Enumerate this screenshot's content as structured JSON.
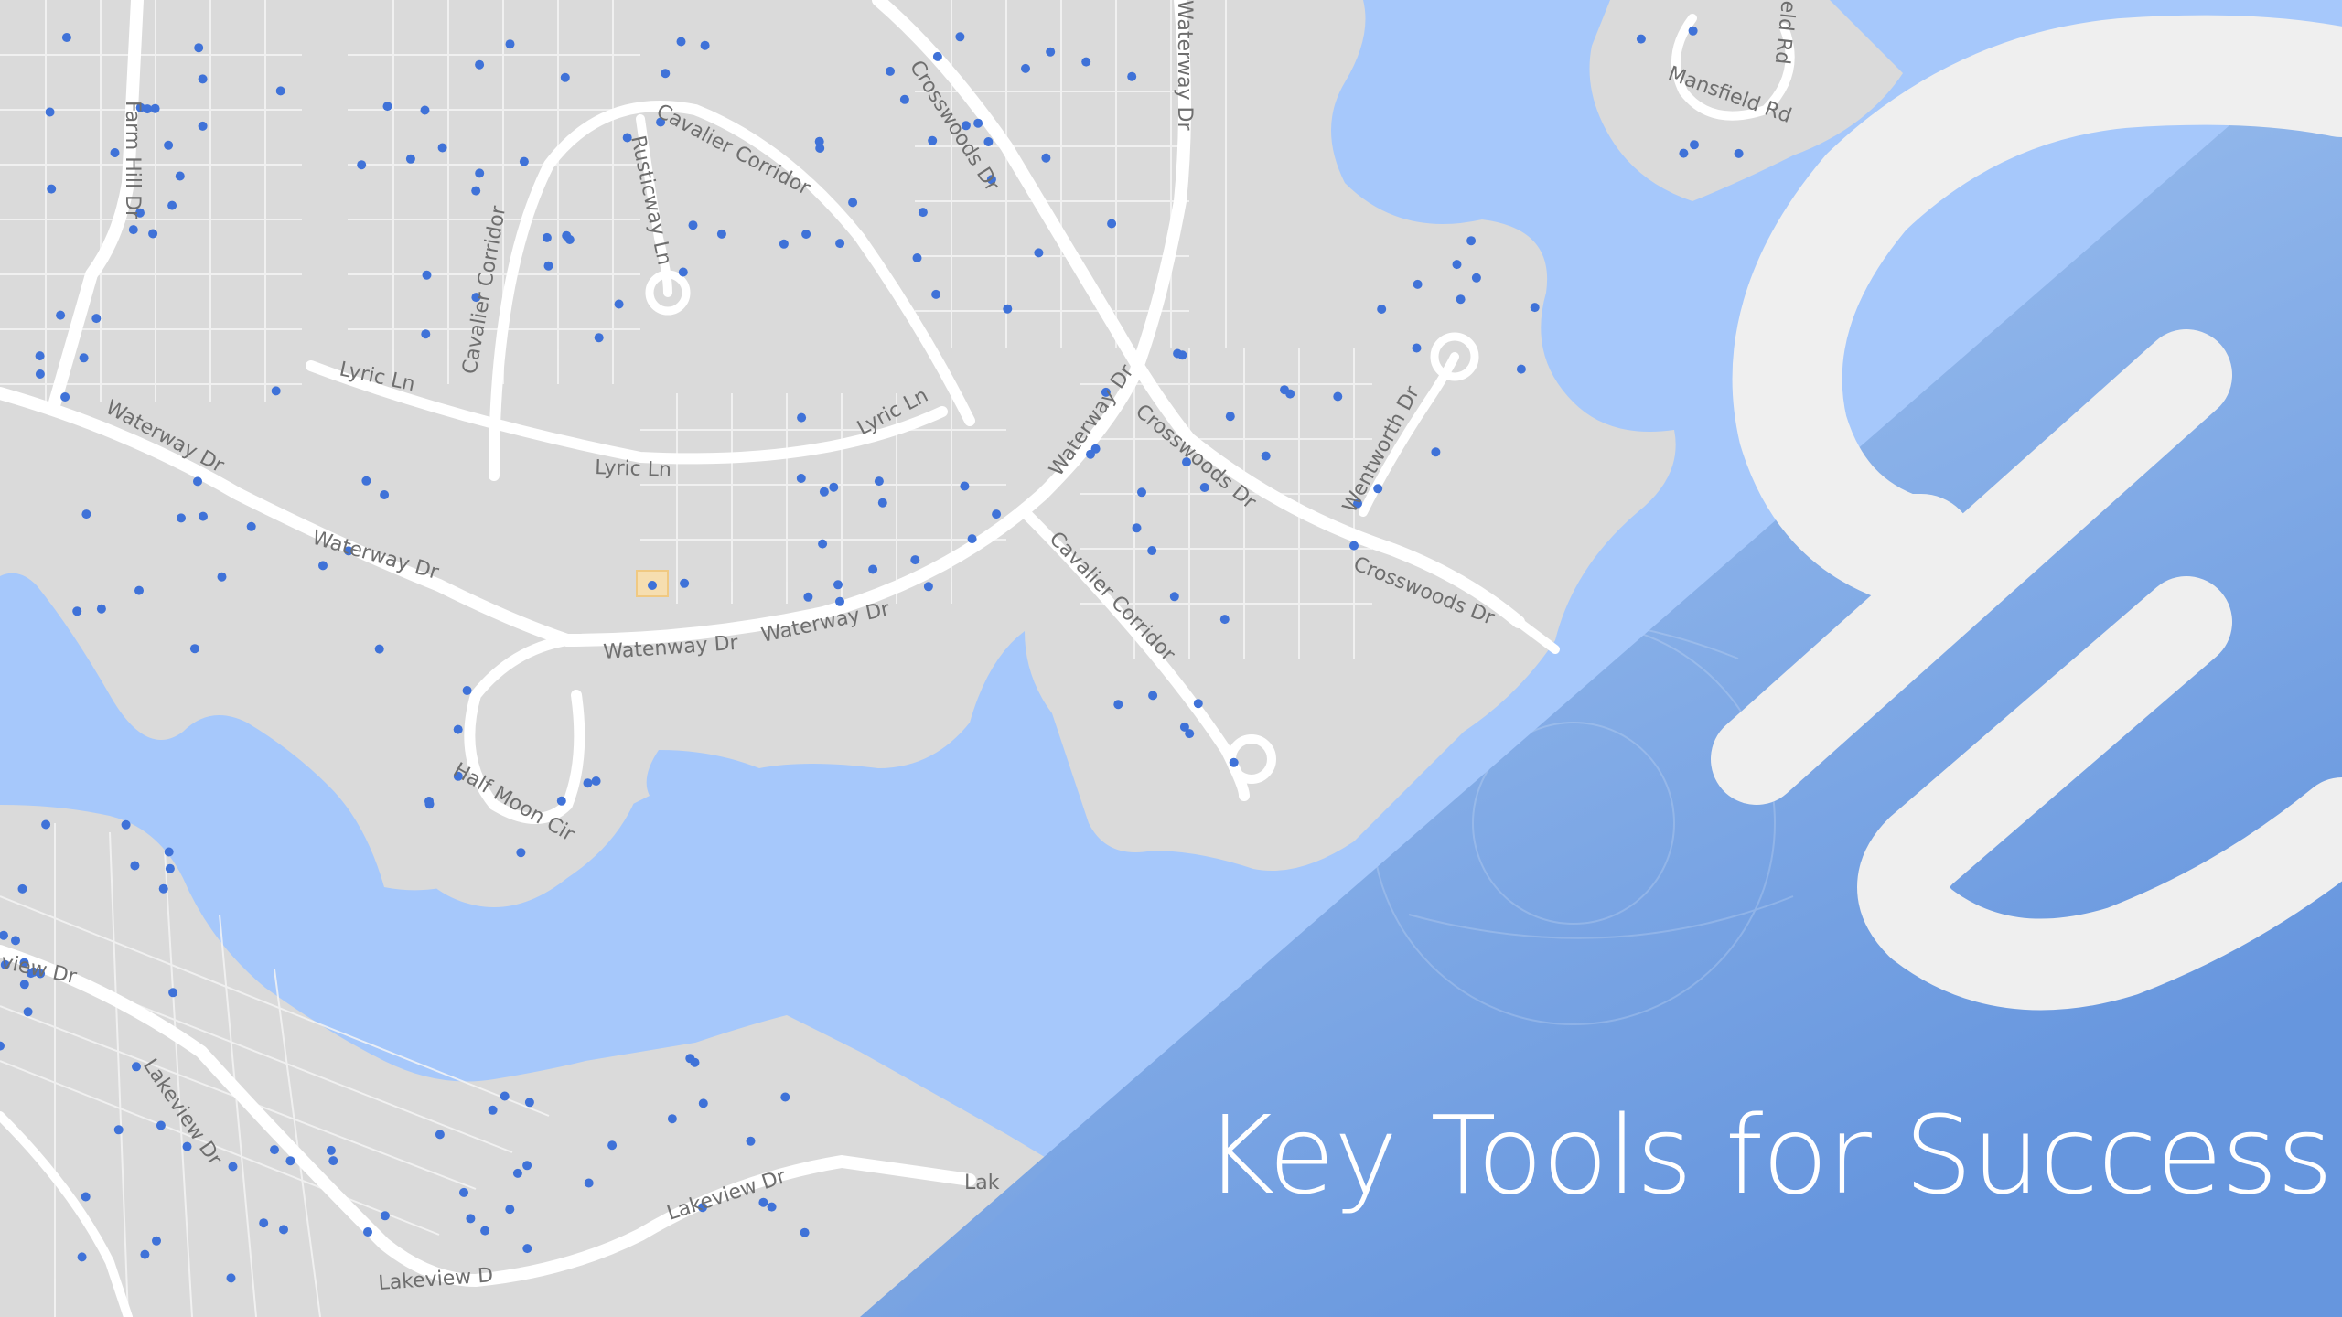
{
  "slide": {
    "title": "Key Tools for Success"
  },
  "map": {
    "roads": [
      "Farm Hill Dr",
      "Cavalier Corridor",
      "Rusticway Ln",
      "Crosswoods Dr",
      "Waterway Dr",
      "Mansfield Rd",
      "Lyric Ln",
      "Wentworth Dr",
      "Half Moon Cir",
      "Lakeview Dr",
      "Lakeview D",
      "Lak",
      "Watenway Dr",
      "eld Rd",
      "view Dr"
    ],
    "colors": {
      "land": "#dadada",
      "water": "#a6c8fb",
      "road": "#ffffff",
      "lot_line": "#ffffff",
      "pin": "#3b6fd6",
      "building": "#e9e9e9",
      "highlight_lot": "#f6deb0"
    }
  },
  "overlay": {
    "colors": {
      "panel_top": "#a9c8f3",
      "panel_bottom": "#6a9de0",
      "logo": "#efefef"
    },
    "logo_icon": "brand-s-logo-icon"
  }
}
